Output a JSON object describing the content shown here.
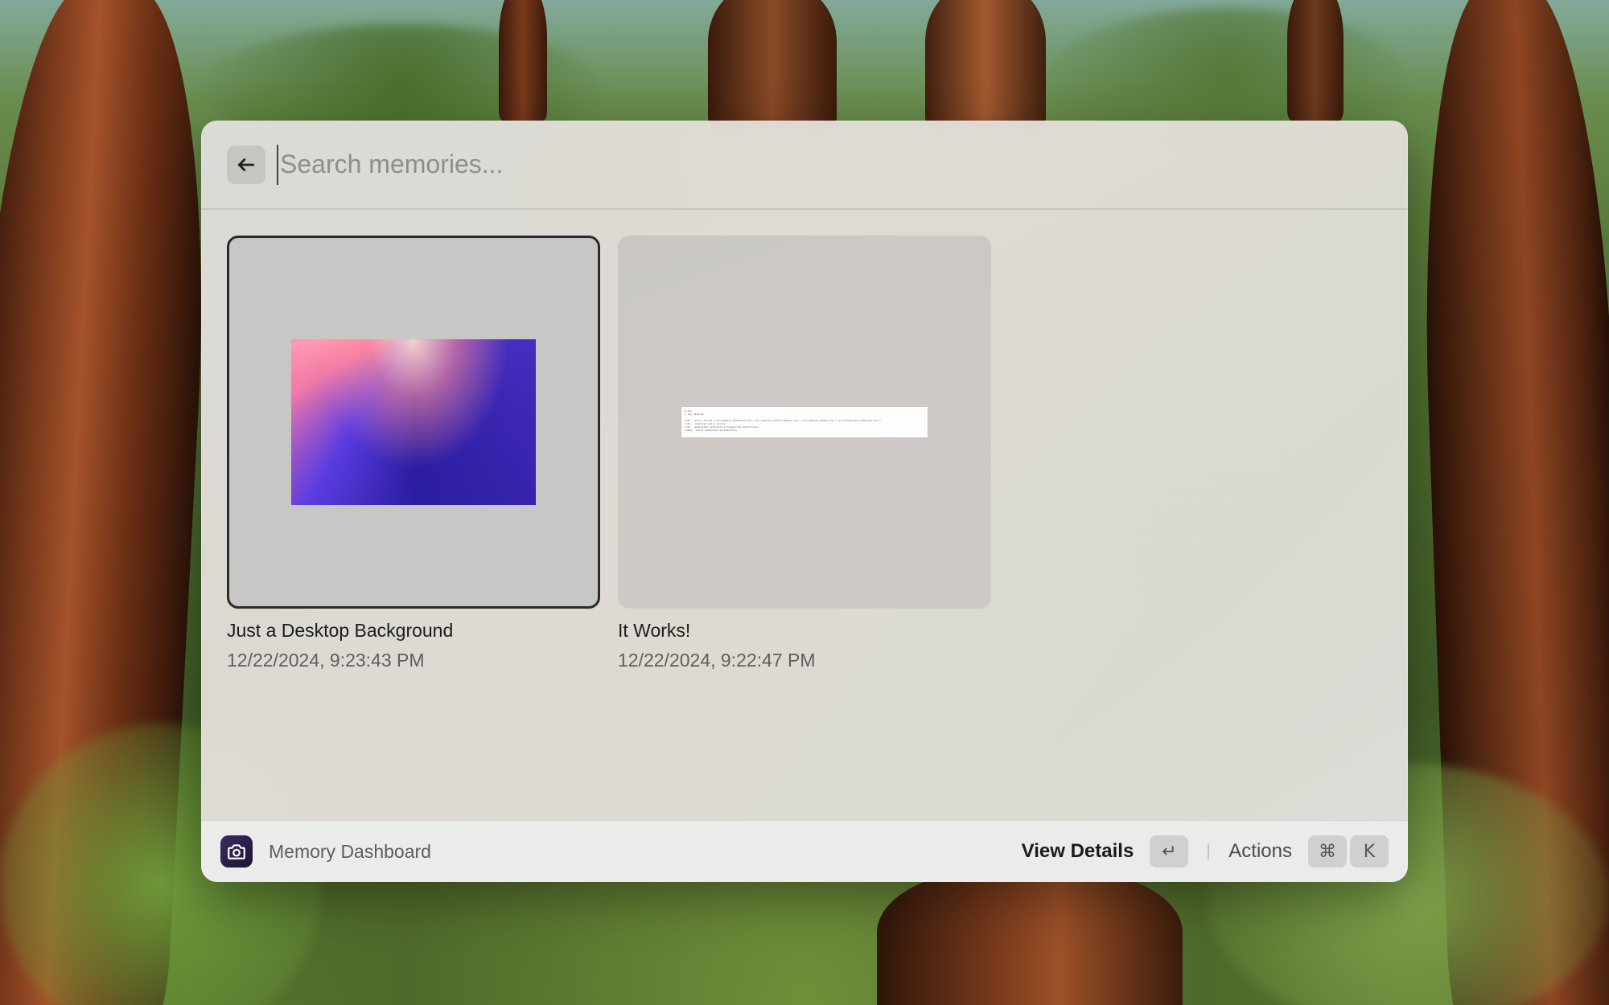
{
  "search": {
    "placeholder": "Search memories..."
  },
  "memories": [
    {
      "title": "Just a Desktop Background",
      "date": "12/22/2024, 9:23:43 PM",
      "selected": true
    },
    {
      "title": "It Works!",
      "date": "12/22/2024, 9:22:47 PM",
      "selected": false
    }
  ],
  "footer": {
    "app_name": "Memory Dashboard",
    "primary_action": "View Details",
    "primary_key": "↵",
    "secondary_action": "Actions",
    "secondary_keys": [
      "⌘",
      "K"
    ]
  },
  "icons": {
    "back": "arrow-left-icon",
    "app": "camera-icon"
  }
}
